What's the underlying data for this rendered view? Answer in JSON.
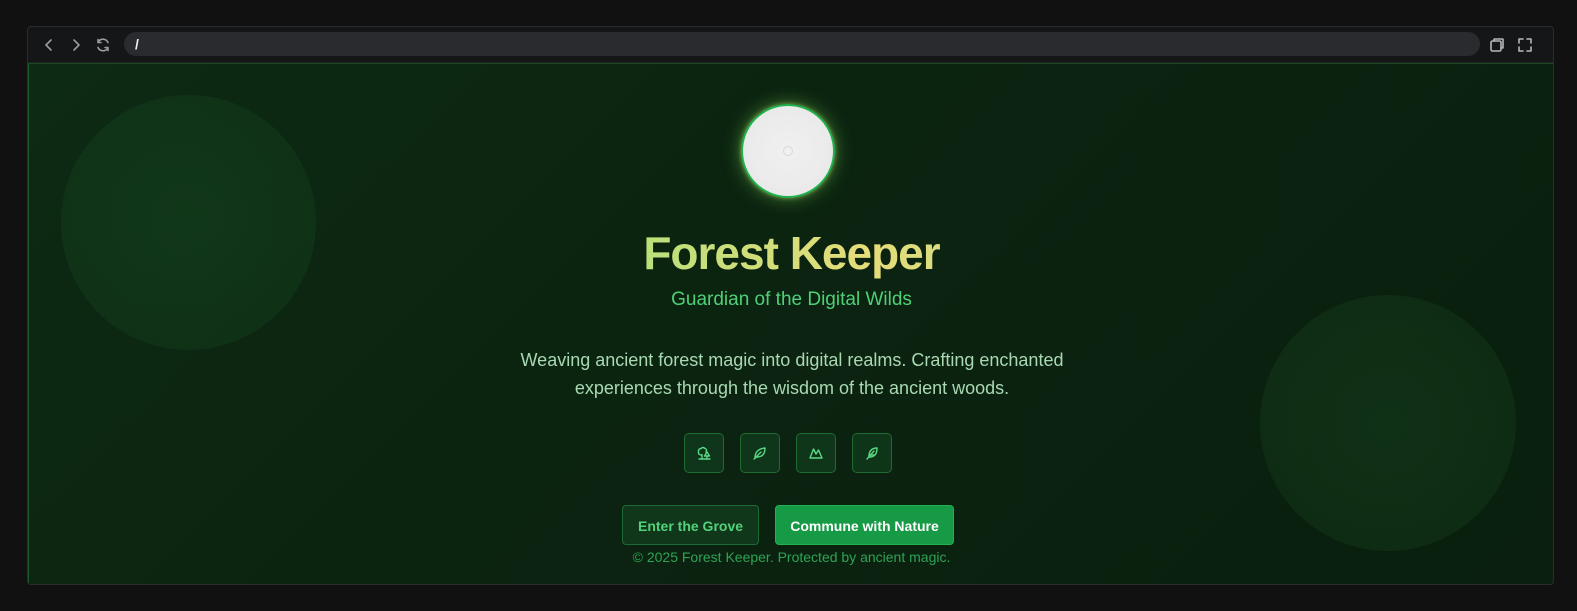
{
  "browser": {
    "url": "/",
    "back_icon": "chevron-left-icon",
    "forward_icon": "chevron-right-icon",
    "reload_icon": "reload-icon",
    "window_icon": "open-window-icon",
    "fullscreen_icon": "fullscreen-icon"
  },
  "hero": {
    "title": "Forest Keeper",
    "subtitle": "Guardian of the Digital Wilds",
    "description": "Weaving ancient forest magic into digital realms. Crafting enchanted experiences through the wisdom of the ancient woods.",
    "icons": [
      "trees-icon",
      "leaf-icon",
      "mountain-icon",
      "feather-icon"
    ],
    "primary_button": "Enter the Grove",
    "secondary_button": "Commune with Nature",
    "footer": "© 2025 Forest Keeper. Protected by ancient magic."
  },
  "colors": {
    "accent": "#22b14c",
    "button_primary_bg": "#179a45",
    "subtitle": "#4fd078",
    "background": "#0b2410"
  }
}
